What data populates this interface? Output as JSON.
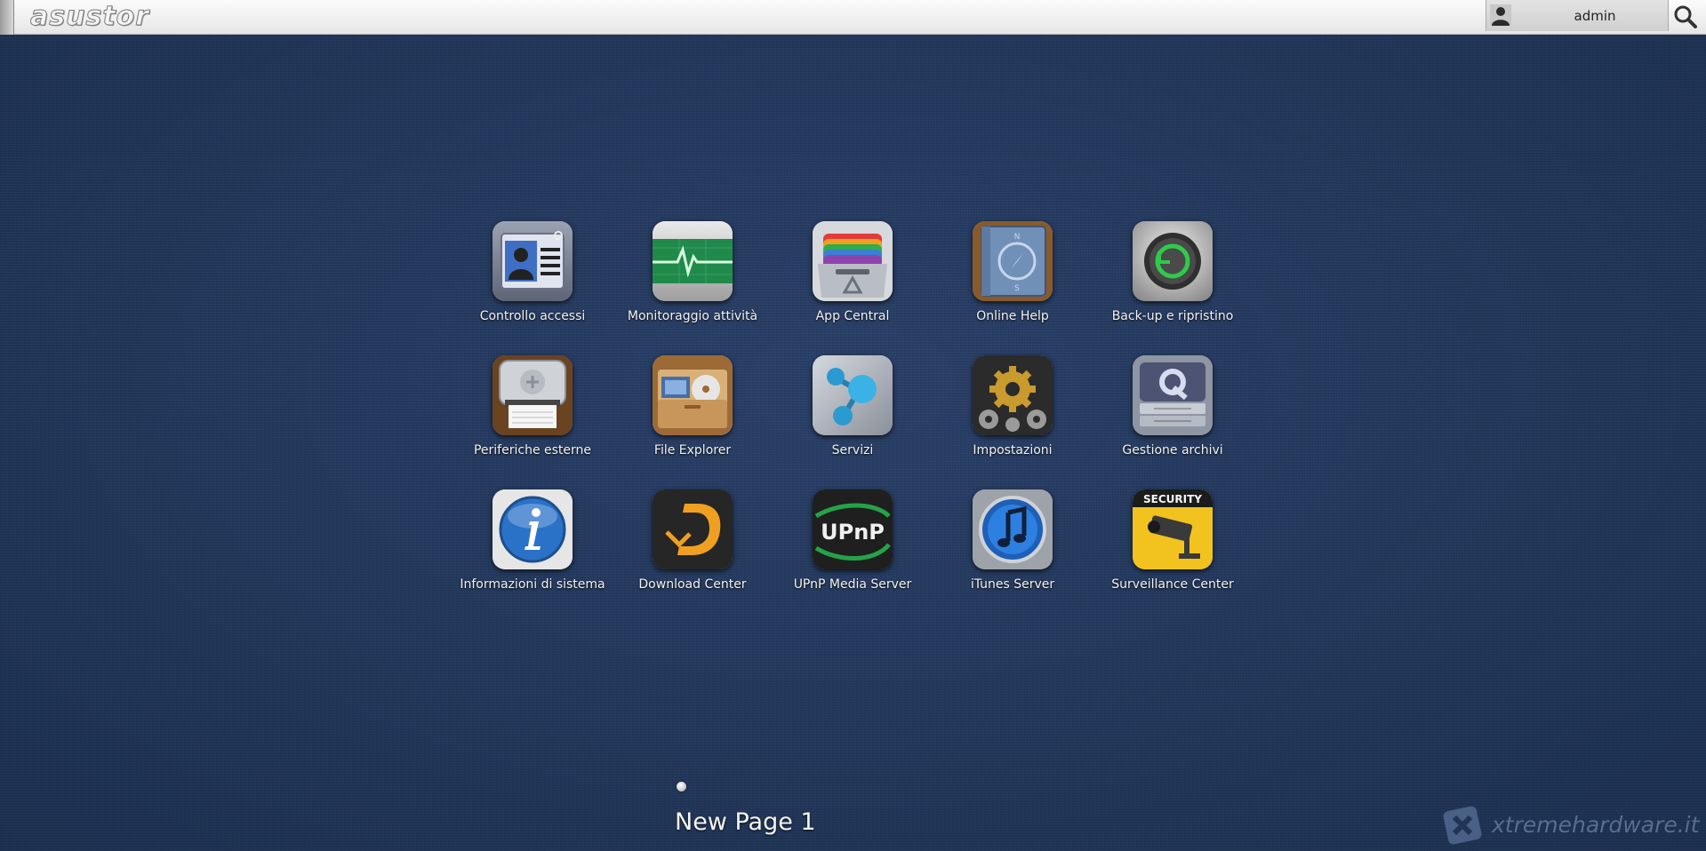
{
  "header": {
    "logo_text": "asustor",
    "user_name": "admin"
  },
  "apps": [
    {
      "label": "Controllo accessi",
      "icon": "access-control-icon"
    },
    {
      "label": "Monitoraggio attività",
      "icon": "activity-monitor-icon"
    },
    {
      "label": "App Central",
      "icon": "app-central-icon"
    },
    {
      "label": "Online Help",
      "icon": "online-help-icon"
    },
    {
      "label": "Back-up e ripristino",
      "icon": "backup-icon"
    },
    {
      "label": "Periferiche esterne",
      "icon": "external-devices-icon"
    },
    {
      "label": "File Explorer",
      "icon": "file-explorer-icon"
    },
    {
      "label": "Servizi",
      "icon": "services-icon"
    },
    {
      "label": "Impostazioni",
      "icon": "settings-gear-icon"
    },
    {
      "label": "Gestione archivi",
      "icon": "storage-manager-icon"
    },
    {
      "label": "Informazioni di sistema",
      "icon": "system-info-icon"
    },
    {
      "label": "Download Center",
      "icon": "download-center-icon"
    },
    {
      "label": "UPnP Media Server",
      "icon": "upnp-media-server-icon"
    },
    {
      "label": "iTunes Server",
      "icon": "itunes-server-icon"
    },
    {
      "label": "Surveillance Center",
      "icon": "surveillance-center-icon"
    }
  ],
  "icon_text": {
    "upnp": "UPnP",
    "security": "SECURITY"
  },
  "pager": {
    "page_title": "New Page 1"
  },
  "watermark": {
    "text": "xtremehardware.it"
  },
  "colors": {
    "desktop_bg": "#22375a",
    "topbar_bg": "#f0f0f0",
    "label_text": "#f2f2f2"
  }
}
